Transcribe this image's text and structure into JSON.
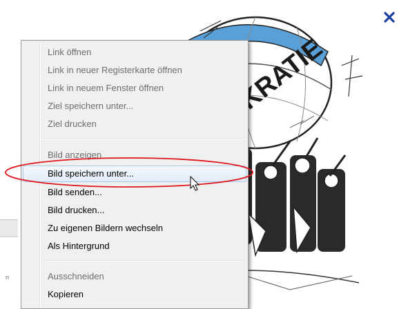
{
  "close_glyph": "✕",
  "image_caption_word": "KRATIE",
  "context_menu": {
    "groups": [
      [
        {
          "label": "Link öffnen",
          "enabled": false
        },
        {
          "label": "Link in neuer Registerkarte öffnen",
          "enabled": false
        },
        {
          "label": "Link in neuem Fenster öffnen",
          "enabled": false
        },
        {
          "label": "Ziel speichern unter...",
          "enabled": false
        },
        {
          "label": "Ziel drucken",
          "enabled": false
        }
      ],
      [
        {
          "label": "Bild anzeigen",
          "enabled": false
        },
        {
          "label": "Bild speichern unter...",
          "enabled": true,
          "highlighted": true
        },
        {
          "label": "Bild senden...",
          "enabled": true
        },
        {
          "label": "Bild drucken...",
          "enabled": true
        },
        {
          "label": "Zu eigenen Bildern wechseln",
          "enabled": true
        },
        {
          "label": "Als Hintergrund",
          "enabled": true
        }
      ],
      [
        {
          "label": "Ausschneiden",
          "enabled": false
        },
        {
          "label": "Kopieren",
          "enabled": true
        }
      ]
    ]
  },
  "colors": {
    "highlight_ellipse": "#e0151b",
    "close_icon": "#1a3fa0",
    "globe_blue": "#5aa0d8",
    "menu_bg": "#f0f0f0"
  },
  "icons": {
    "close": "close-icon",
    "cursor": "mouse-pointer-icon"
  }
}
